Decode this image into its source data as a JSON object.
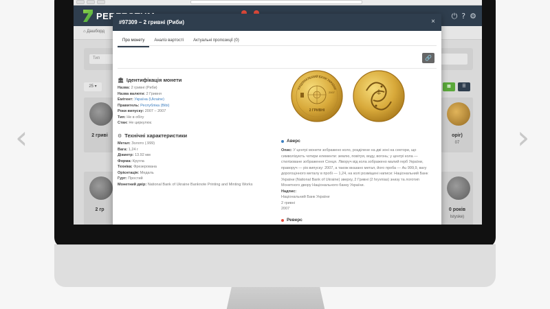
{
  "modal": {
    "title": "#97309 – 2 гривні (Риби)",
    "close_symbol": "×",
    "tabs": [
      "Про монету",
      "Аналіз вартості",
      "Актуальні пропозиції (0)"
    ],
    "link_icon": "link-icon"
  },
  "identification": {
    "title": "Ідентифікація монети",
    "rows": [
      {
        "label": "Назва:",
        "value": "2 гривні (Риби)"
      },
      {
        "label": "Назва валюти:",
        "value": "2 Гривня"
      },
      {
        "label": "Емітент:",
        "value": "Україна (Ukraine)"
      },
      {
        "label": "Правитель:",
        "value": "Республіка (Bibi)"
      },
      {
        "label": "Роки випуску:",
        "value": "2007 – 2007"
      },
      {
        "label": "Тип:",
        "value": "Не в обігу"
      },
      {
        "label": "Стан:",
        "value": "Не циркулює"
      }
    ]
  },
  "technical": {
    "title": "Технічні характеристики",
    "rows": [
      {
        "label": "Метал:",
        "value": "Золото (.999)"
      },
      {
        "label": "Вага:",
        "value": "1,24 г"
      },
      {
        "label": "Діаметр:",
        "value": "13.92 мм"
      },
      {
        "label": "Форма:",
        "value": "Кругла"
      },
      {
        "label": "Техніка:",
        "value": "Фрезерована"
      },
      {
        "label": "Орієнтація:",
        "value": "Медаль"
      },
      {
        "label": "Гурт:",
        "value": "Простий"
      },
      {
        "label": "Монетний двір:",
        "value": "National Bank of Ukraine Banknote Printing and Minting Works"
      }
    ]
  },
  "obverse": {
    "title": "Аверс",
    "desc_label": "Опис:",
    "desc_text": "У центрі монети зображено коло, розділене на дві зоні на сектори, що символізують чотири елементи: землю, повітря, воду, вогонь; у центрі кола — стилізоване зображення Сонця. Ліворуч від кола зображено малий герб України, праворуч — рік випуску: 2007, а також вказано метал, його проба — Au 999,9, вагу дорогоцінного металу в пробі — 1,24, на колі розміщені написи: Національний Банк України (National Bank of Ukraine) зверху, 2 Гривні (2 hryvnias) знизу та логотип Монетного двору Національного банку України.",
    "legend_label": "Надпис:",
    "legend_lines": [
      "Національний Банк України",
      "2 гривні",
      "2007"
    ]
  },
  "reverse": {
    "title": "Реверс"
  },
  "coin_text": {
    "obverse_ring": "НАЦІОНАЛЬНИЙ БАНК УКРАЇНИ",
    "obverse_value": "2 ГРИВНІ",
    "obverse_year": "2007"
  },
  "background": {
    "app_name": "PERFECTUM",
    "breadcrumb": "Дашборд",
    "search_placeholder": "Тип",
    "per_page": "25",
    "cards": [
      {
        "title": "2 гриві",
        "sub": ""
      },
      {
        "title": "2 гр",
        "sub": ""
      },
      {
        "title": "оріг)",
        "sub": "07"
      },
      {
        "title": "0 років",
        "sub": "lstyske)"
      }
    ]
  },
  "colors": {
    "header": "#2f3e4e",
    "gold": "#d8a93a",
    "accent_green": "#5aa83a",
    "link": "#3c7ebf"
  }
}
